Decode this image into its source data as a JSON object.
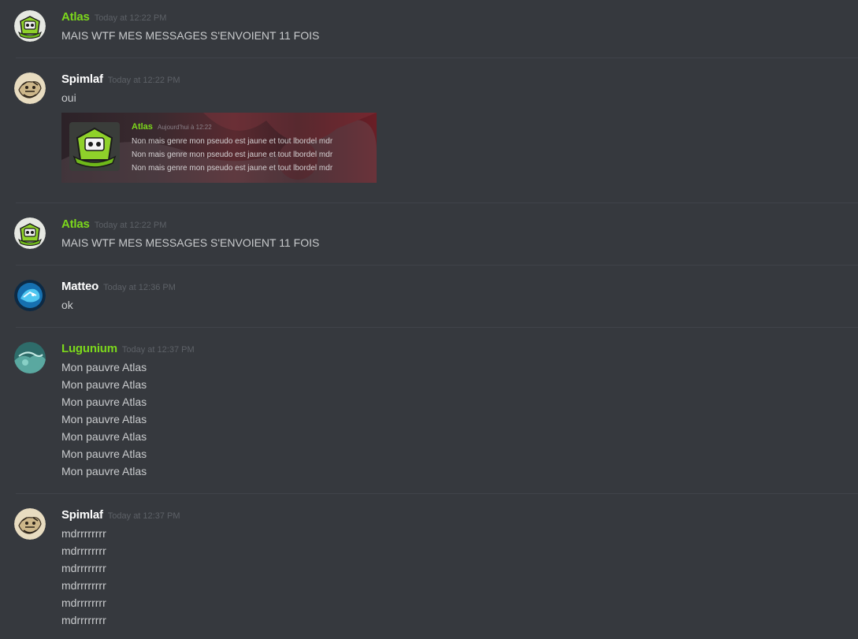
{
  "colors": {
    "background": "#36393e",
    "username_green": "#7cd81c",
    "username_white": "#ffffff",
    "timestamp": "#5d6167",
    "message_text": "#c9cbcd"
  },
  "messages": [
    {
      "username": "Atlas",
      "name_color": "#7cd81c",
      "timestamp": "Today at 12:22 PM",
      "avatar_icon": "green-robot-avatar",
      "lines": [
        "MAIS WTF MES MESSAGES S'ENVOIENT 11 FOIS"
      ]
    },
    {
      "username": "Spimlaf",
      "name_color": "#ffffff",
      "timestamp": "Today at 12:22 PM",
      "avatar_icon": "sketch-avatar",
      "lines": [
        "oui"
      ],
      "embed": {
        "username": "Atlas",
        "name_color": "#7cd81c",
        "timestamp": "Aujourd'hui à 12:22",
        "lines": [
          "Non mais genre mon pseudo est jaune et tout lbordel mdr",
          "Non mais genre mon pseudo est jaune et tout lbordel mdr",
          "Non mais genre mon pseudo est jaune et tout lbordel mdr"
        ]
      }
    },
    {
      "username": "Atlas",
      "name_color": "#7cd81c",
      "timestamp": "Today at 12:22 PM",
      "avatar_icon": "green-robot-avatar",
      "lines": [
        "MAIS WTF MES MESSAGES S'ENVOIENT 11 FOIS"
      ]
    },
    {
      "username": "Matteo",
      "name_color": "#ffffff",
      "timestamp": "Today at 12:36 PM",
      "avatar_icon": "blue-creature-avatar",
      "lines": [
        "ok"
      ]
    },
    {
      "username": "Lugunium",
      "name_color": "#7cd81c",
      "timestamp": "Today at 12:37 PM",
      "avatar_icon": "teal-landscape-avatar",
      "lines": [
        "Mon pauvre Atlas",
        "Mon pauvre Atlas",
        "Mon pauvre Atlas",
        "Mon pauvre Atlas",
        "Mon pauvre Atlas",
        "Mon pauvre Atlas",
        "Mon pauvre Atlas"
      ]
    },
    {
      "username": "Spimlaf",
      "name_color": "#ffffff",
      "timestamp": "Today at 12:37 PM",
      "avatar_icon": "sketch-avatar",
      "lines": [
        "mdrrrrrrrr",
        "mdrrrrrrrr",
        "mdrrrrrrrr",
        "mdrrrrrrrr",
        "mdrrrrrrrr",
        "mdrrrrrrrr"
      ]
    }
  ]
}
